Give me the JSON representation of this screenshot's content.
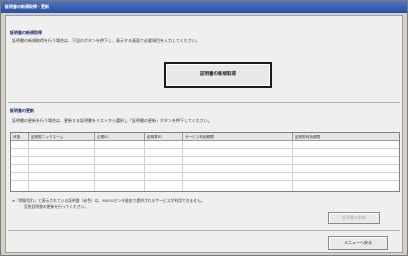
{
  "window": {
    "title": "証明書の新規取得・更新"
  },
  "new_section": {
    "heading": "証明書の新規取得",
    "description": "証明書の新規取得を行う場合は、下記のボタンを押下し、表示する画面で必要項目を入力してください。",
    "button_label": "証明書の新規取得"
  },
  "update_section": {
    "heading": "証明書の更新",
    "description": "証明書の更新を行う場合は、更新する証明書をリストから選択し「証明書の更新」ボタンを押下してください。",
    "columns": [
      "状態",
      "証明書ニックネーム",
      "企業ID",
      "証明書ID",
      "サービス利用期間",
      "証明書有効期限"
    ],
    "rows": [
      [
        "",
        "",
        "",
        "",
        "",
        ""
      ],
      [
        "",
        "",
        "",
        "",
        "",
        ""
      ],
      [
        "",
        "",
        "",
        "",
        "",
        ""
      ],
      [
        "",
        "",
        "",
        "",
        "",
        ""
      ],
      [
        "",
        "",
        "",
        "",
        "",
        ""
      ],
      [
        "",
        "",
        "",
        "",
        "",
        ""
      ]
    ],
    "note_line1": "※「期限切れ」と表示されている証明書（赤色）は、MUFGセンタ経由で提供されるサービスが利用できません。",
    "note_line2": "至急証明書の更新を行ってください。",
    "update_button_label": "証明書の更新"
  },
  "footer": {
    "back_button_label": "メニューへ戻る"
  }
}
